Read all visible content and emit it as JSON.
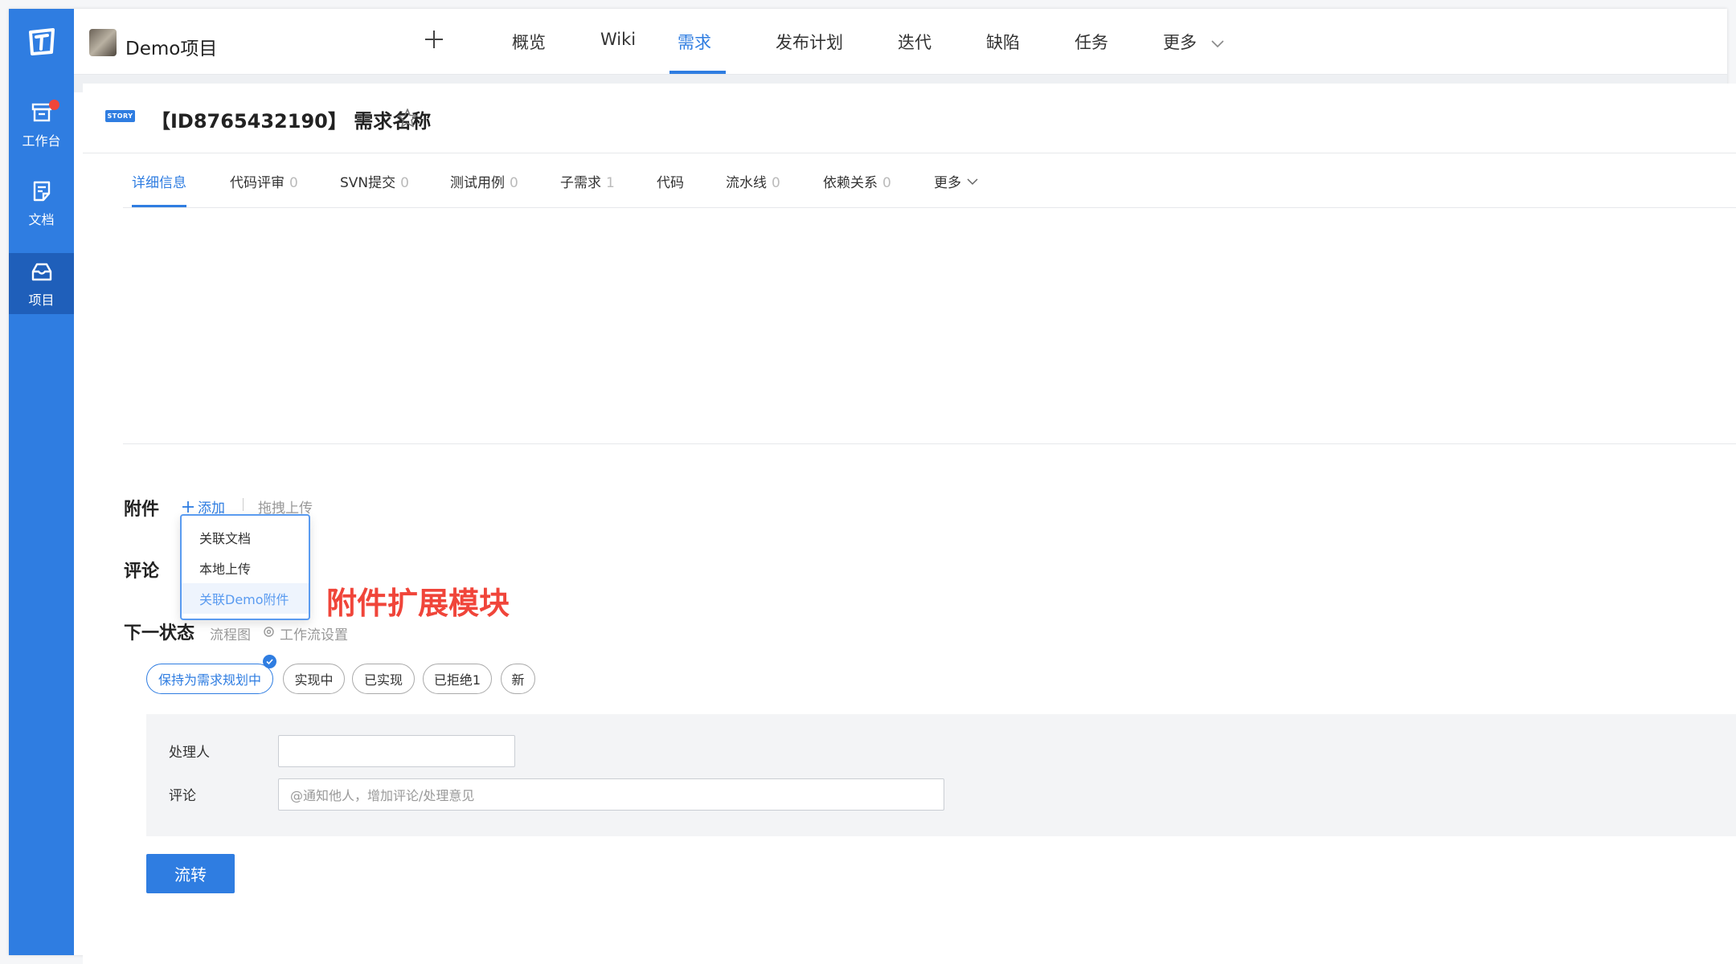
{
  "sidebar": {
    "items": [
      {
        "label": "工作台",
        "icon": "inbox-icon"
      },
      {
        "label": "文档",
        "icon": "document-icon"
      },
      {
        "label": "项目",
        "icon": "box-icon"
      }
    ]
  },
  "topbar": {
    "project_name": "Demo项目",
    "nav": [
      "概览",
      "Wiki",
      "需求",
      "发布计划",
      "迭代",
      "缺陷",
      "任务",
      "更多"
    ],
    "active_nav": "需求"
  },
  "story": {
    "badge": "STORY",
    "title": "【ID8765432190】 需求名称"
  },
  "tabs": [
    {
      "label": "详细信息",
      "count": ""
    },
    {
      "label": "代码评审",
      "count": "0"
    },
    {
      "label": "SVN提交",
      "count": "0"
    },
    {
      "label": "测试用例",
      "count": "0"
    },
    {
      "label": "子需求",
      "count": "1"
    },
    {
      "label": "代码",
      "count": ""
    },
    {
      "label": "流水线",
      "count": "0"
    },
    {
      "label": "依赖关系",
      "count": "0"
    },
    {
      "label": "更多",
      "count": ""
    }
  ],
  "attachments": {
    "label": "附件",
    "add": "添加",
    "drag_upload": "拖拽上传",
    "menu": [
      "关联文档",
      "本地上传",
      "关联Demo附件"
    ],
    "annotation": "附件扩展模块"
  },
  "comment_label": "评论",
  "next_state": {
    "label": "下一状态",
    "flowchart": "流程图",
    "workflow_settings": "工作流设置",
    "states": [
      "保持为需求规划中",
      "实现中",
      "已实现",
      "已拒绝1",
      "新"
    ],
    "selected": "保持为需求规划中"
  },
  "form": {
    "assignee_label": "处理人",
    "assignee_value": "",
    "comment_label": "评论",
    "comment_placeholder": "@通知他人，增加评论/处理意见"
  },
  "submit_label": "流转",
  "colors": {
    "accent": "#2f7de1",
    "sidebar": "#2f7de1",
    "annotation": "#f0453a"
  }
}
